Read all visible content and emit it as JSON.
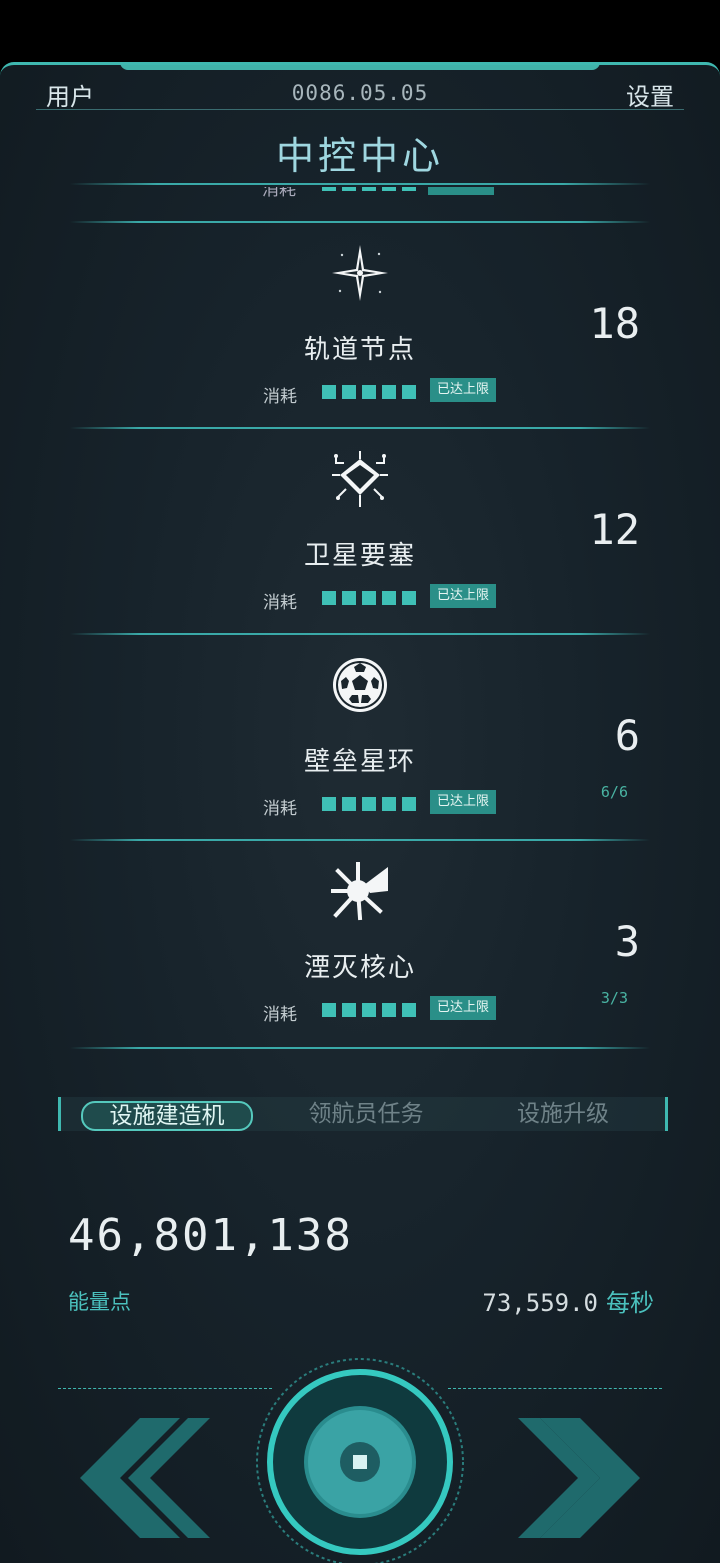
{
  "header": {
    "user_label": "用户",
    "date": "0086.05.05",
    "settings_label": "设置",
    "title": "中控中心"
  },
  "list": {
    "peek_cost_label": "消耗",
    "items": [
      {
        "icon": "compass-star-icon",
        "name": "轨道节点",
        "cost_label": "消耗",
        "cost_pips": 5,
        "badge": "已达上限",
        "count": "18",
        "sub": ""
      },
      {
        "icon": "satellite-fortress-icon",
        "name": "卫星要塞",
        "cost_label": "消耗",
        "cost_pips": 5,
        "badge": "已达上限",
        "count": "12",
        "sub": ""
      },
      {
        "icon": "geodesic-sphere-icon",
        "name": "壁垒星环",
        "cost_label": "消耗",
        "cost_pips": 5,
        "badge": "已达上限",
        "count": "6",
        "sub": "6/6"
      },
      {
        "icon": "starburst-core-icon",
        "name": "湮灭核心",
        "cost_label": "消耗",
        "cost_pips": 5,
        "badge": "已达上限",
        "count": "3",
        "sub": "3/3"
      }
    ]
  },
  "tabs": [
    {
      "label": "设施建造机",
      "active": true
    },
    {
      "label": "领航员任务",
      "active": false
    },
    {
      "label": "设施升级",
      "active": false
    }
  ],
  "resources": {
    "energy_value": "46,801,138",
    "energy_label": "能量点",
    "rate_value": "73,559.0",
    "rate_unit": "每秒"
  },
  "colors": {
    "accent": "#3fb8b0",
    "badge": "#2a8f88",
    "background": "#17232b"
  },
  "controls": {
    "prev_icon": "double-chevron-left-icon",
    "next_icon": "double-chevron-right-icon",
    "center_icon": "core-button-icon"
  }
}
